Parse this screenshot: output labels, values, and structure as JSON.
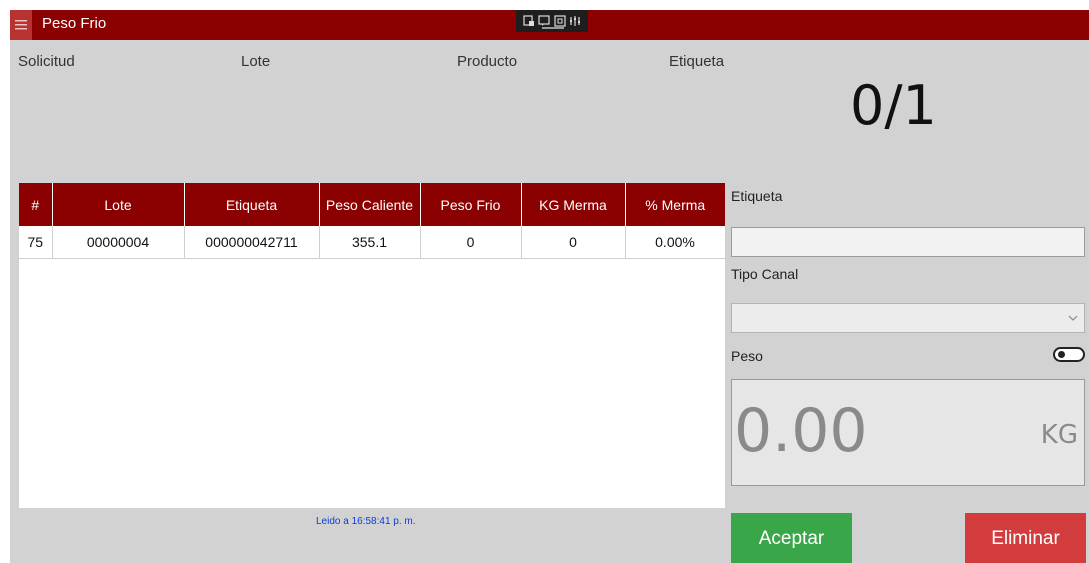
{
  "app": {
    "title": "Peso Frio"
  },
  "header": {
    "solicitud_label": "Solicitud",
    "lote_label": "Lote",
    "producto_label": "Producto",
    "etiqueta_label": "Etiqueta",
    "counter": "0/1"
  },
  "table": {
    "columns": [
      "#",
      "Lote",
      "Etiqueta",
      "Peso Caliente",
      "Peso Frio",
      "KG Merma",
      "% Merma"
    ],
    "rows": [
      [
        "75",
        "00000004",
        "000000042711",
        "355.1",
        "0",
        "0",
        "0.00%"
      ]
    ]
  },
  "status": {
    "read_time": "Leido a 16:58:41 p. m."
  },
  "form": {
    "etiqueta_label": "Etiqueta",
    "etiqueta_value": "",
    "tipo_canal_label": "Tipo Canal",
    "tipo_canal_value": "",
    "peso_label": "Peso",
    "weight_value": "0.00",
    "weight_unit": "KG"
  },
  "buttons": {
    "accept": "Aceptar",
    "delete": "Eliminar"
  },
  "colors": {
    "titlebar": "#8b0000",
    "accent": "#8b0000",
    "accept": "#3aa64a",
    "delete": "#d33c3c",
    "status_text": "#0b3bd9"
  },
  "icons": [
    "hamburger-menu-icon",
    "capture-tool-icon",
    "chevron-down-icon"
  ]
}
